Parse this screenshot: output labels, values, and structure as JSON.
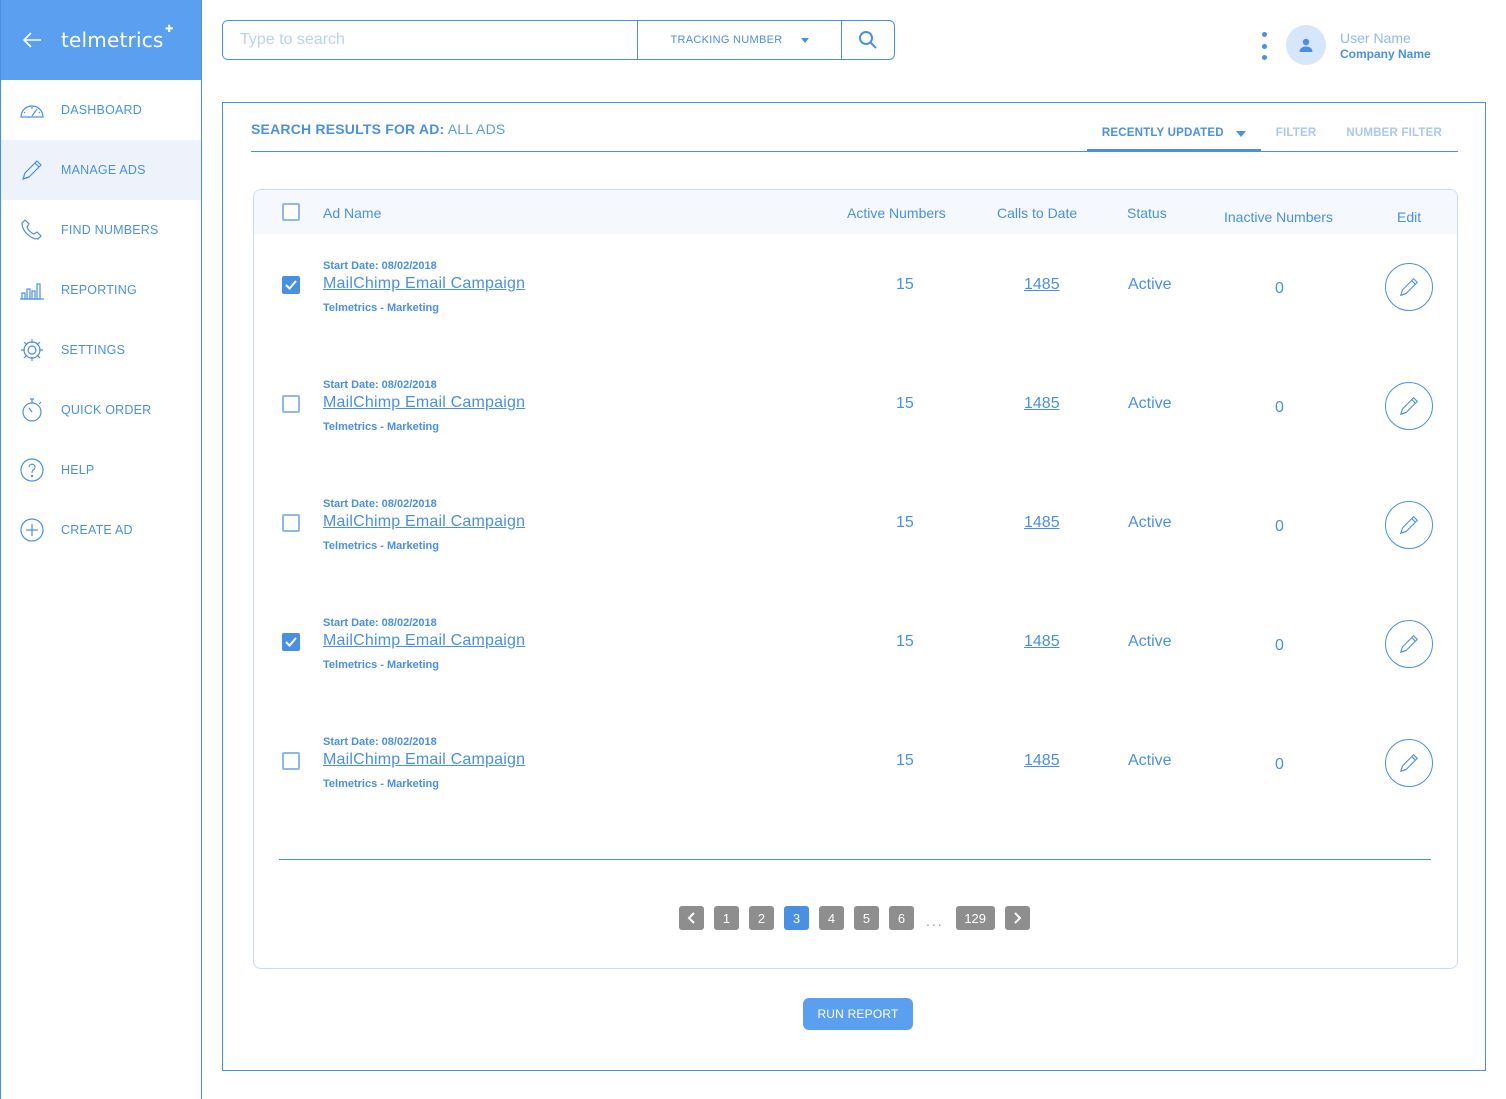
{
  "brand": {
    "name": "telmetrics",
    "mark": "✚",
    "color": "#5b9ff0"
  },
  "sidebar": {
    "items": [
      {
        "label": "DASHBOARD",
        "icon": "speedometer-icon"
      },
      {
        "label": "MANAGE ADS",
        "icon": "pencil-icon",
        "active": true
      },
      {
        "label": "FIND NUMBERS",
        "icon": "phone-icon"
      },
      {
        "label": "REPORTING",
        "icon": "bar-chart-icon"
      },
      {
        "label": "SETTINGS",
        "icon": "gear-icon"
      },
      {
        "label": "QUICK ORDER",
        "icon": "stopwatch-icon"
      },
      {
        "label": "HELP",
        "icon": "question-icon"
      },
      {
        "label": "CREATE AD",
        "icon": "plus-circle-icon"
      }
    ]
  },
  "search": {
    "placeholder": "Type to search",
    "value": "",
    "type_label": "TRACKING NUMBER"
  },
  "user": {
    "name": "User Name",
    "company": "Company Name"
  },
  "results": {
    "label": "SEARCH RESULTS FOR AD:",
    "value": "ALL ADS",
    "tabs": [
      {
        "label": "RECENTLY UPDATED",
        "active": true
      },
      {
        "label": "FILTER"
      },
      {
        "label": "NUMBER FILTER"
      }
    ]
  },
  "table": {
    "columns": {
      "ad_name": "Ad Name",
      "active_numbers": "Active Numbers",
      "calls_to_date": "Calls to Date",
      "status": "Status",
      "inactive_numbers": "Inactive Numbers",
      "edit": "Edit"
    },
    "rows": [
      {
        "checked": true,
        "start_date": "Start Date: 08/02/2018",
        "name": "MailChimp Email Campaign",
        "company": "Telmetrics - Marketing",
        "active_numbers": "15",
        "calls": "1485",
        "status": "Active",
        "inactive": "0"
      },
      {
        "checked": false,
        "start_date": "Start Date: 08/02/2018",
        "name": "MailChimp Email Campaign",
        "company": "Telmetrics - Marketing",
        "active_numbers": "15",
        "calls": "1485",
        "status": "Active",
        "inactive": "0"
      },
      {
        "checked": false,
        "start_date": "Start Date: 08/02/2018",
        "name": "MailChimp Email Campaign",
        "company": "Telmetrics - Marketing",
        "active_numbers": "15",
        "calls": "1485",
        "status": "Active",
        "inactive": "0"
      },
      {
        "checked": true,
        "start_date": "Start Date: 08/02/2018",
        "name": "MailChimp Email Campaign",
        "company": "Telmetrics - Marketing",
        "active_numbers": "15",
        "calls": "1485",
        "status": "Active",
        "inactive": "0"
      },
      {
        "checked": false,
        "start_date": "Start Date: 08/02/2018",
        "name": "MailChimp Email Campaign",
        "company": "Telmetrics - Marketing",
        "active_numbers": "15",
        "calls": "1485",
        "status": "Active",
        "inactive": "0"
      }
    ]
  },
  "pagination": {
    "pages": [
      "1",
      "2",
      "3",
      "4",
      "5",
      "6"
    ],
    "current": "3",
    "ellipsis": "...",
    "last": "129"
  },
  "actions": {
    "run_report": "RUN REPORT"
  }
}
